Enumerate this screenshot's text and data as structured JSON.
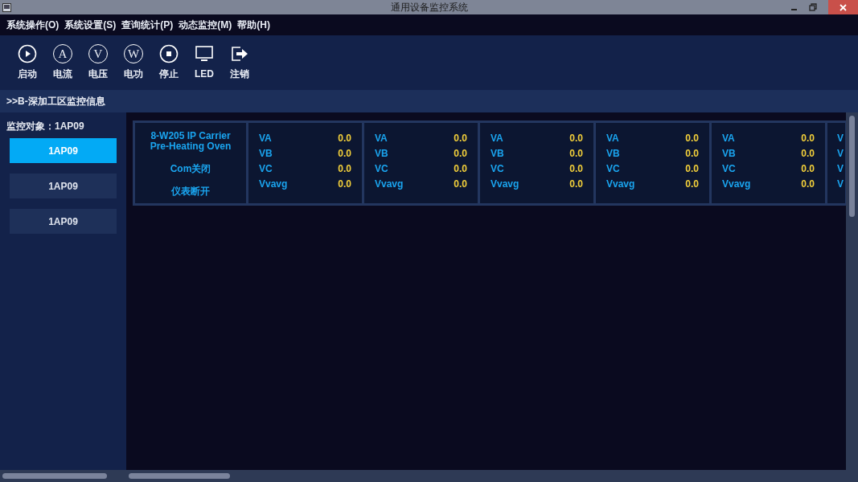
{
  "window": {
    "title": "通用设备监控系统"
  },
  "menu": [
    "系统操作(O)",
    "系统设置(S)",
    "查询统计(P)",
    "动态监控(M)",
    "帮助(H)"
  ],
  "toolbar": [
    {
      "kind": "play",
      "label": "启动"
    },
    {
      "kind": "letter",
      "glyph": "A",
      "label": "电流"
    },
    {
      "kind": "letter",
      "glyph": "V",
      "label": "电压"
    },
    {
      "kind": "letter",
      "glyph": "W",
      "label": "电功"
    },
    {
      "kind": "stop",
      "label": "停止"
    },
    {
      "kind": "monitor",
      "label": "LED"
    },
    {
      "kind": "exit",
      "label": "注销"
    }
  ],
  "breadcrumb": ">>B-深加工区监控信息",
  "sidebar": {
    "label": "监控对象：1AP09",
    "items": [
      {
        "label": "1AP09",
        "selected": true
      },
      {
        "label": "1AP09",
        "selected": false
      },
      {
        "label": "1AP09",
        "selected": false
      }
    ]
  },
  "device": {
    "name": "8-W205 IP Carrier Pre-Heating Oven",
    "com_status": "Com关闭",
    "meter_status": "仪表断开"
  },
  "meters": [
    {
      "kind": "full",
      "readings": [
        {
          "label": "VA",
          "value": "0.0"
        },
        {
          "label": "VB",
          "value": "0.0"
        },
        {
          "label": "VC",
          "value": "0.0"
        },
        {
          "label": "Vvavg",
          "value": "0.0"
        }
      ]
    },
    {
      "kind": "full",
      "readings": [
        {
          "label": "VA",
          "value": "0.0"
        },
        {
          "label": "VB",
          "value": "0.0"
        },
        {
          "label": "VC",
          "value": "0.0"
        },
        {
          "label": "Vvavg",
          "value": "0.0"
        }
      ]
    },
    {
      "kind": "full",
      "readings": [
        {
          "label": "VA",
          "value": "0.0"
        },
        {
          "label": "VB",
          "value": "0.0"
        },
        {
          "label": "VC",
          "value": "0.0"
        },
        {
          "label": "Vvavg",
          "value": "0.0"
        }
      ]
    },
    {
      "kind": "full",
      "readings": [
        {
          "label": "VA",
          "value": "0.0"
        },
        {
          "label": "VB",
          "value": "0.0"
        },
        {
          "label": "VC",
          "value": "0.0"
        },
        {
          "label": "Vvavg",
          "value": "0.0"
        }
      ]
    },
    {
      "kind": "full",
      "readings": [
        {
          "label": "VA",
          "value": "0.0"
        },
        {
          "label": "VB",
          "value": "0.0"
        },
        {
          "label": "VC",
          "value": "0.0"
        },
        {
          "label": "Vvavg",
          "value": "0.0"
        }
      ]
    },
    {
      "kind": "partial",
      "readings": [
        {
          "label": "V"
        },
        {
          "label": "V"
        },
        {
          "label": "V"
        },
        {
          "label": "V"
        }
      ]
    }
  ]
}
